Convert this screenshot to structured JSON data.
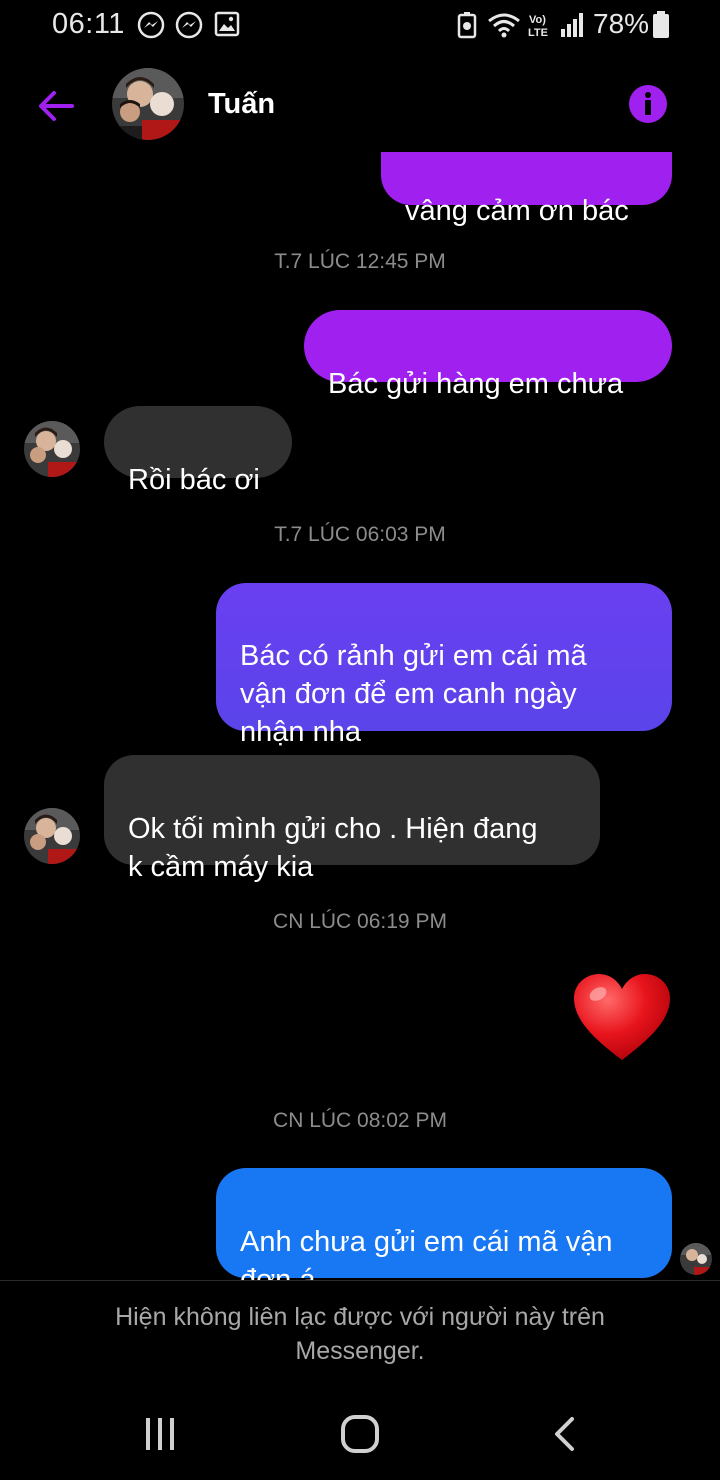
{
  "status_bar": {
    "time": "06:11",
    "battery": "78%",
    "icons": [
      "messenger-icon",
      "messenger-icon",
      "image-icon",
      "battery-saver-icon",
      "wifi-icon",
      "volte-icon",
      "signal-icon",
      "battery-icon"
    ]
  },
  "header": {
    "contact_name": "Tuấn",
    "accent_color": "#a020f0"
  },
  "messages": [
    {
      "dir": "out",
      "text": "vâng cảm ơn bác"
    },
    {
      "type": "timestamp",
      "text": "T.7 LÚC 12:45 PM"
    },
    {
      "dir": "out",
      "text": "Bác gửi hàng em chưa"
    },
    {
      "dir": "in",
      "text": "Rồi bác ơi"
    },
    {
      "type": "timestamp",
      "text": "T.7 LÚC 06:03 PM"
    },
    {
      "dir": "out",
      "text": "Bác có rảnh gửi em cái mã\nvận đơn để em canh ngày\nnhận nha"
    },
    {
      "dir": "in",
      "text": "Ok tối mình gửi cho . Hiện đang\nk cầm máy kia"
    },
    {
      "type": "timestamp",
      "text": "CN LÚC 06:19 PM"
    },
    {
      "dir": "out",
      "type": "reaction",
      "icon": "heart-icon"
    },
    {
      "type": "timestamp",
      "text": "CN LÚC 08:02 PM"
    },
    {
      "dir": "out",
      "text": "Anh chưa gửi em cái mã vận\nđơn á"
    }
  ],
  "footer": {
    "note": "Hiện không liên lạc được với người này trên Messenger."
  },
  "nav_bar": {
    "icons": [
      "recent-apps-icon",
      "home-icon",
      "back-icon"
    ]
  }
}
